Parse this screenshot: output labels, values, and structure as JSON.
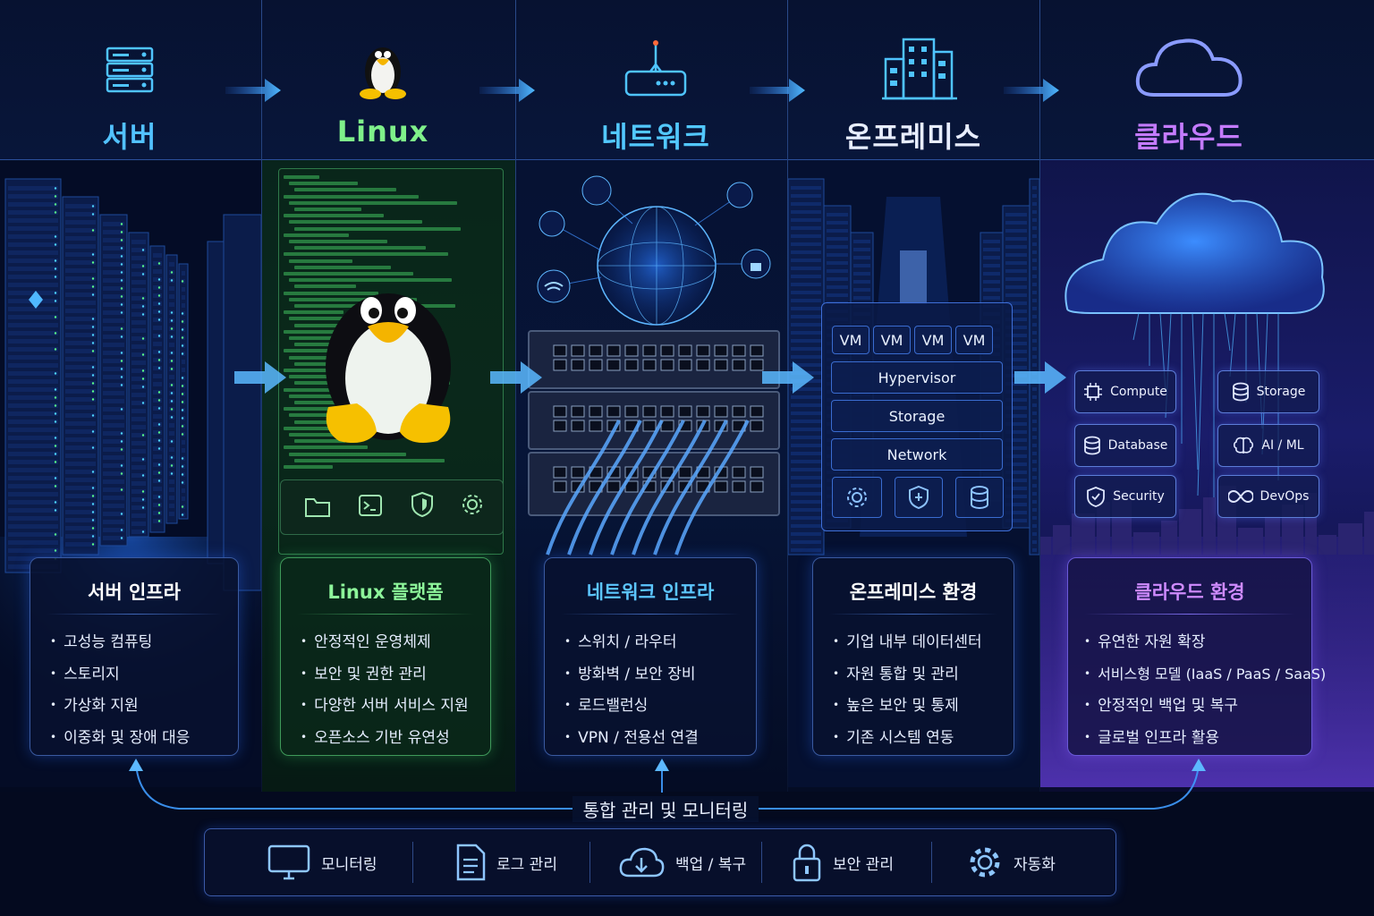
{
  "columns": [
    {
      "title": "서버",
      "color": "#52c2ff",
      "card_title": "서버 인프라",
      "card_color": "#ffffff",
      "items": [
        "고성능 컴퓨팅",
        "스토리지",
        "가상화 지원",
        "이중화 및 장애 대응"
      ]
    },
    {
      "title": "Linux",
      "color": "#7ff08a",
      "card_title": "Linux 플랫폼",
      "card_color": "#8df59a",
      "items": [
        "안정적인 운영체제",
        "보안 및 권한 관리",
        "다양한 서버 서비스 지원",
        "오픈소스 기반 유연성"
      ]
    },
    {
      "title": "네트워크",
      "color": "#52c8ff",
      "card_title": "네트워크 인프라",
      "card_color": "#5cc6ff",
      "items": [
        "스위치 / 라우터",
        "방화벽 / 보안 장비",
        "로드밸런싱",
        "VPN / 전용선 연결"
      ]
    },
    {
      "title": "온프레미스",
      "color": "#e8eeff",
      "card_title": "온프레미스 환경",
      "card_color": "#ffffff",
      "items": [
        "기업 내부 데이터센터",
        "자원 통합 및 관리",
        "높은 보안 및 통제",
        "기존 시스템 연동"
      ]
    },
    {
      "title": "클라우드",
      "color": "#c47bff",
      "card_title": "클라우드 환경",
      "card_color": "#cf8bff",
      "items": [
        "유연한 자원 확장",
        "서비스형 모델 (IaaS / PaaS / SaaS)",
        "안정적인 백업 및 복구",
        "글로벌 인프라 활용"
      ]
    }
  ],
  "onprem_stack": {
    "vms": [
      "VM",
      "VM",
      "VM",
      "VM"
    ],
    "layers": [
      "Hypervisor",
      "Storage",
      "Network"
    ],
    "icons": [
      "gear-icon",
      "shield-icon",
      "database-icon"
    ]
  },
  "cloud_services": [
    {
      "label": "Compute",
      "icon": "chip-icon"
    },
    {
      "label": "Storage",
      "icon": "database-icon"
    },
    {
      "label": "Database",
      "icon": "database-icon"
    },
    {
      "label": "AI / ML",
      "icon": "brain-icon"
    },
    {
      "label": "Security",
      "icon": "shield-icon"
    },
    {
      "label": "DevOps",
      "icon": "infinity-icon"
    }
  ],
  "linux_toolbar_icons": [
    "folder-icon",
    "terminal-icon",
    "shield-icon",
    "gear-icon"
  ],
  "management": {
    "label": "통합 관리 및 모니터링",
    "items": [
      {
        "label": "모니터링",
        "icon": "monitor-icon"
      },
      {
        "label": "로그 관리",
        "icon": "document-icon"
      },
      {
        "label": "백업 / 복구",
        "icon": "cloud-download-icon"
      },
      {
        "label": "보안 관리",
        "icon": "lock-icon"
      },
      {
        "label": "자동화",
        "icon": "gear-icon"
      }
    ]
  },
  "colors": {
    "background": "#040a1f",
    "accent_blue": "#3ea8ff",
    "linux_green": "#7ff08a",
    "cloud_purple": "#c47bff"
  }
}
